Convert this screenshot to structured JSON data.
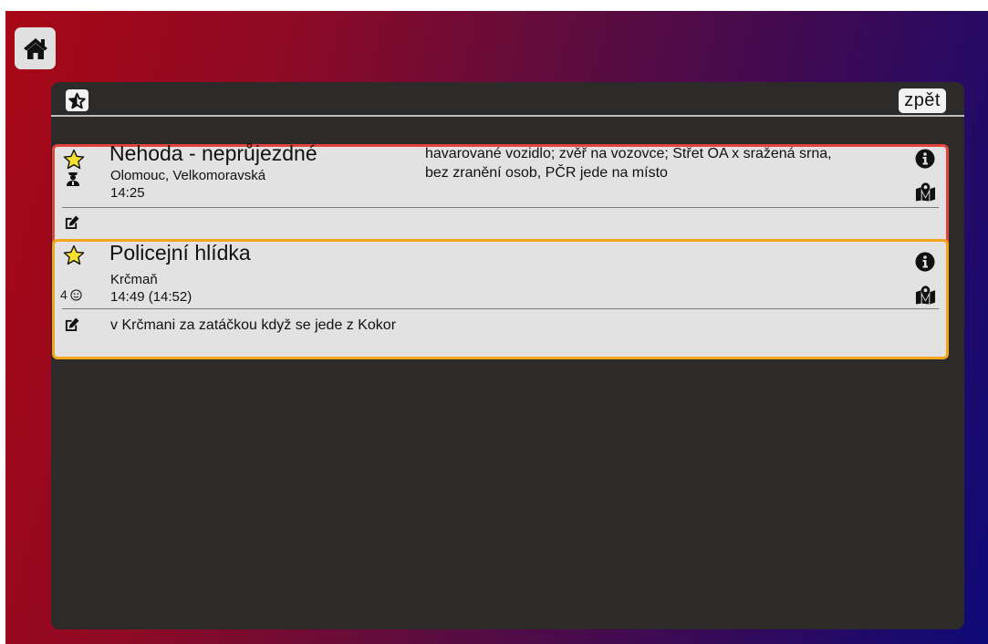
{
  "toolbar": {
    "back_label": "zpět"
  },
  "colors": {
    "accent_red": "#e0453c",
    "accent_orange": "#f1a41c",
    "star_yellow": "#f7e030",
    "panel": "#2c2b2a"
  },
  "events": [
    {
      "title": "Nehoda - neprůjezdné",
      "place": "Olomouc, Velkomoravská",
      "time": "14:25",
      "description": "havarované vozidlo; zvěř na vozovce; Střet OA x sražená srna, bez zranění osob, PČR jede na místo",
      "note": "",
      "icon": "police-officer-icon"
    },
    {
      "title": "Policejní hlídka",
      "place": "Krčmaň",
      "time": "14:49 (14:52)",
      "description": "",
      "note": "v Krčmani za zatáčkou když se jede z Kokor",
      "count": "4"
    }
  ]
}
